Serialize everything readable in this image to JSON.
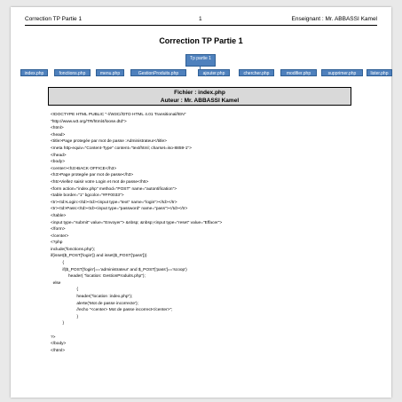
{
  "header": {
    "left": "Correction TP Partie 1",
    "page": "1",
    "right": "Enseignant : Mr. ABBASSI Kamel"
  },
  "title": "Correction TP Partie 1",
  "tree": {
    "root": "Tp partie 1",
    "children": [
      "index.php",
      "fonctions.php",
      "menu.php",
      "GestionProduits.php",
      "ajouter.php",
      "chercher.php",
      "modifier.php",
      "supprimer.php",
      "lister.php"
    ]
  },
  "file_box": {
    "line1": "Fichier : index.php",
    "line2": "Auteur : Mr. ABBASSI Kamel"
  },
  "code_lines": [
    "<!DOCTYPE HTML PUBLIC \"-//W3C//DTD HTML 4.01 Transitional//EN\"",
    "\"http://www.w3.org/TR/html4/loose.dtd\">",
    "<html>",
    "<head>",
    "<title>Page protegée par mot de passe :Administrateur</title>",
    "<meta http-equiv=\"Content-Type\" content=\"text/html; charset=iso-8859-1\">",
    "</head>",
    "<body>",
    "<center><h3>BACK OFFICE</h3>",
    "<h3>Page protegée par mot de passe</h3>",
    "<h5>Viellez saisir votre Login et mot de passe</h5>",
    "<form action=\"index.php\" method=\"POST\" name=\"autontification\">",
    "<table border=\"1\" bgcolor=\"#FF0033\">",
    "<tr><td>Login:</td><td><input type=\"text\" name=\"login\"></td></tr>",
    "<tr><td>Pass:</td><td><input type=\"password\" name=\"pass\"></td></tr>",
    "</table>",
    "<input type=\"submit\" value=\"Envoyer\"> &nbsp; &nbsp;<input type=\"reset\" value=\"Effacer\">",
    "</form>",
    "</center>",
    "<?php",
    "include('fonctions.php');",
    "if(isset($_POST['login']) and isset($_POST['pass']))",
    "          {",
    "          if($_POST['login']=='administrateur' and $_POST['pass']=='scoop')",
    "               header( \"location: GestionProduits.php\");",
    "  else",
    "                      {",
    "                      header(\"location :index.php\");",
    "                      alerte('Mot de passe incorrecte');",
    "                      //echo \"<center> Mot de passe incorrect</center>\";",
    "                      }",
    "          }",
    "",
    "?>",
    "</body>",
    "</html>"
  ]
}
